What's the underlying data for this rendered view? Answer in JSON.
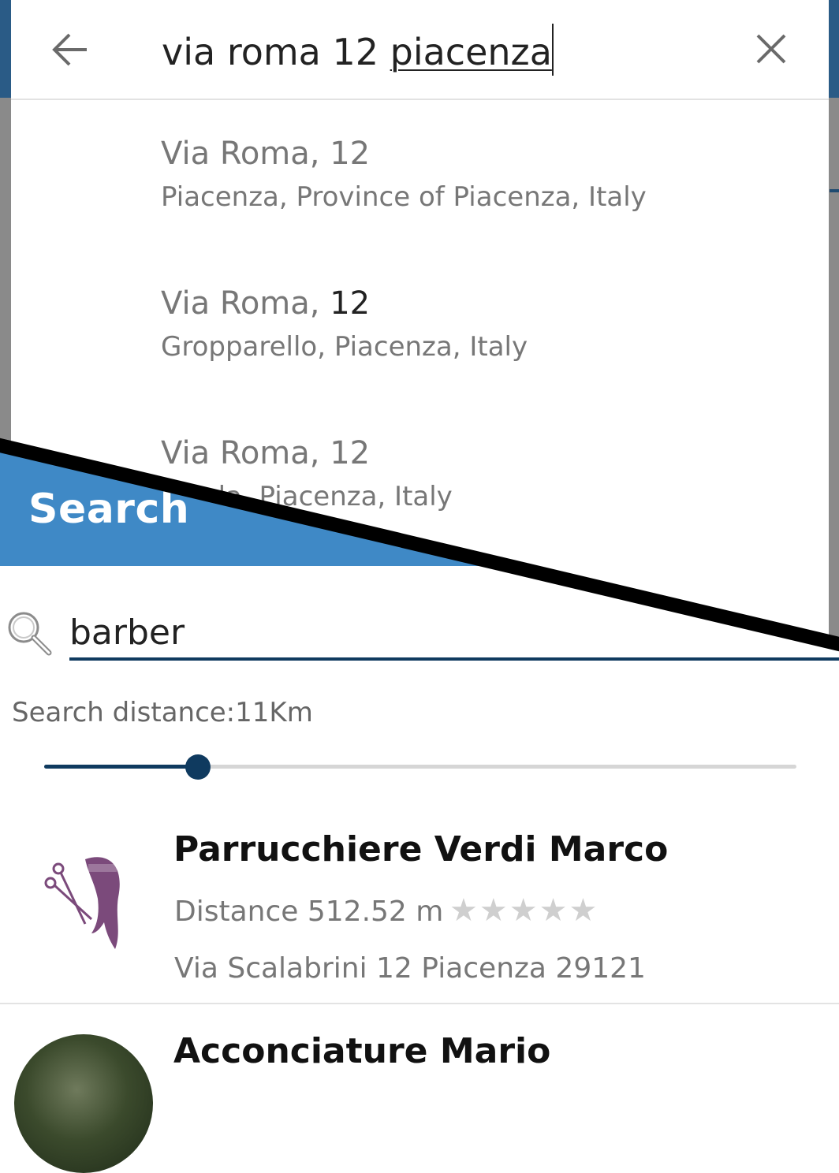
{
  "bottom": {
    "header_title": "Search",
    "search": {
      "value": "barber",
      "placeholder": ""
    },
    "distance_label": "Search distance:11Km",
    "distance_slider_fraction": 0.204,
    "results": [
      {
        "name": "Parrucchiere Verdi Marco",
        "distance": "Distance 512.52 m",
        "stars": "★★★★★",
        "rating": 0,
        "address": "Via Scalabrini 12 Piacenza 29121",
        "logo_icon": "scissors-hair-logo-icon"
      },
      {
        "name": "Acconciature Mario",
        "avatar": "shop-avatar-photo"
      }
    ]
  },
  "top": {
    "query": {
      "plain": "via roma 12 ",
      "composing_word": "piacenza"
    },
    "back_icon": "back-arrow-icon",
    "clear_icon": "close-icon",
    "suggestions": [
      {
        "street": "Via Roma",
        "sep": ", ",
        "number": "12",
        "number_dark": false,
        "detail": "Piacenza, Province of Piacenza, Italy"
      },
      {
        "street": "Via Roma",
        "sep": ", ",
        "number": "12",
        "number_dark": true,
        "detail": "Gropparello, Piacenza, Italy"
      },
      {
        "street": "Via Roma",
        "sep": ", ",
        "number": "12",
        "number_dark": false,
        "detail": "…zola, Piacenza, Italy"
      }
    ]
  },
  "colors": {
    "header_blue": "#3f89c6",
    "accent_navy": "#0f3a5f",
    "logo_purple": "#7b4a7b"
  }
}
